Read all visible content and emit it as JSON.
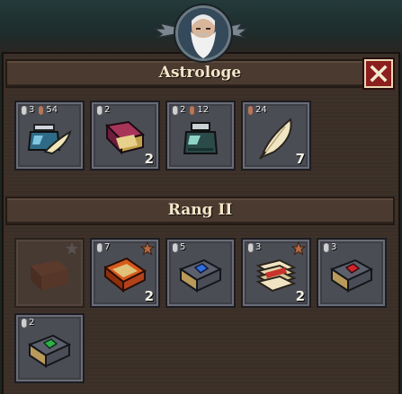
{
  "header": {
    "title": "Astrologe",
    "close_icon": "close-icon",
    "portrait": "astrologer-portrait"
  },
  "ingredients": [
    {
      "icon": "ink-bottle-quill-icon",
      "silver": "3",
      "bronze": "54",
      "qty": ""
    },
    {
      "icon": "open-red-book-icon",
      "silver": "2",
      "bronze": "",
      "qty": "2"
    },
    {
      "icon": "ink-bottle-icon",
      "silver": "2",
      "bronze": "12",
      "qty": ""
    },
    {
      "icon": "quill-feather-icon",
      "silver": "",
      "bronze": "24",
      "qty": "7"
    }
  ],
  "rank": {
    "title": "Rang II"
  },
  "recipes": [
    {
      "icon": "locked-book-icon",
      "silver": "",
      "qty": "",
      "star": "grey",
      "locked": true
    },
    {
      "icon": "open-orange-book-icon",
      "silver": "7",
      "qty": "2",
      "star": "bronze",
      "locked": false
    },
    {
      "icon": "blue-gem-book-icon",
      "silver": "5",
      "qty": "",
      "star": "",
      "locked": false
    },
    {
      "icon": "scroll-stack-icon",
      "silver": "3",
      "qty": "2",
      "star": "bronze",
      "locked": false
    },
    {
      "icon": "red-gem-book-icon",
      "silver": "3",
      "qty": "",
      "star": "",
      "locked": false
    },
    {
      "icon": "green-gem-book-icon",
      "silver": "2",
      "qty": "",
      "star": "",
      "locked": false
    }
  ]
}
